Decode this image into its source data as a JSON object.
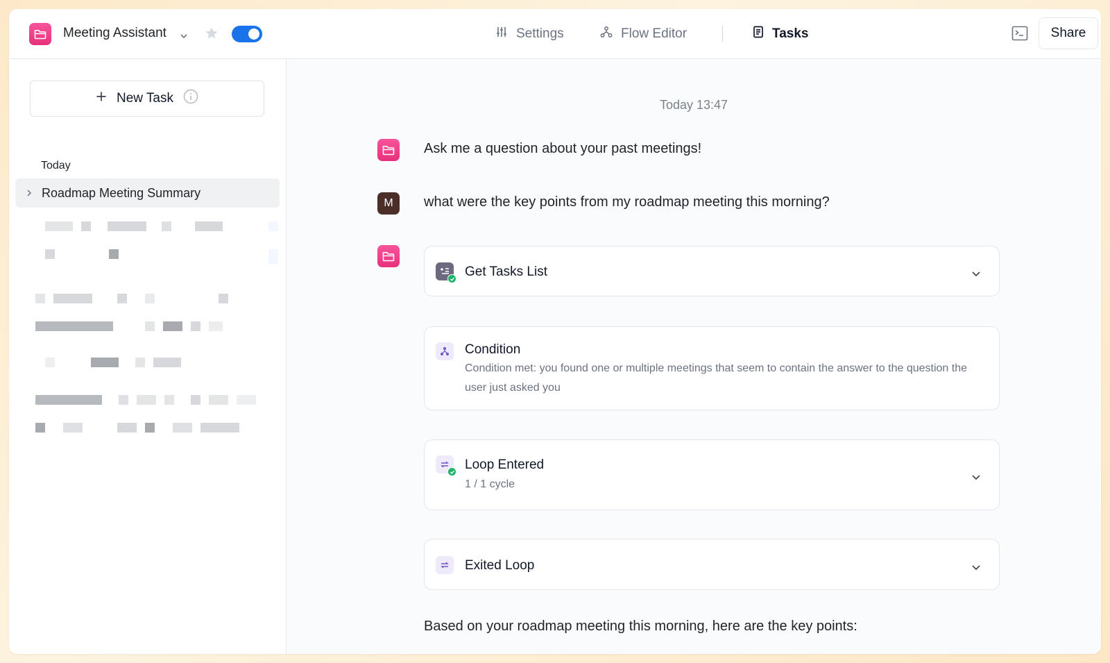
{
  "header": {
    "app_name": "Meeting Assistant",
    "nav": [
      {
        "label": "Settings",
        "icon": "sliders-icon",
        "active": false
      },
      {
        "label": "Flow Editor",
        "icon": "flow-icon",
        "active": false
      },
      {
        "label": "Tasks",
        "icon": "document-icon",
        "active": true
      }
    ],
    "share_label": "Share",
    "toggle_on": true,
    "accent_color": "#1a73e8",
    "brand_color": "#ef3f8a"
  },
  "sidebar": {
    "new_task_label": "New Task",
    "section_label": "Today",
    "items": [
      {
        "label": "Roadmap Meeting Summary",
        "selected": true
      }
    ]
  },
  "chat": {
    "timestamp": "Today 13:47",
    "bot_greeting": "Ask me a question about your past meetings!",
    "user_avatar_letter": "M",
    "user_question": "what were the key points from my roadmap meeting this morning?",
    "steps": [
      {
        "title": "Get Tasks List",
        "subtitle": "",
        "icon": "tasks-check-icon",
        "status": "success",
        "expandable": true
      },
      {
        "title": "Condition",
        "subtitle": "Condition met: you found one or multiple meetings that seem to contain the answer to the question the user just asked you",
        "icon": "branch-icon",
        "expandable": false
      },
      {
        "title": "Loop Entered",
        "subtitle": "1 / 1 cycle",
        "icon": "loop-icon",
        "status": "success",
        "expandable": true
      },
      {
        "title": "Exited Loop",
        "subtitle": "",
        "icon": "loop-icon",
        "expandable": true
      }
    ],
    "answer_intro": "Based on your roadmap meeting this morning, here are the key points:"
  }
}
